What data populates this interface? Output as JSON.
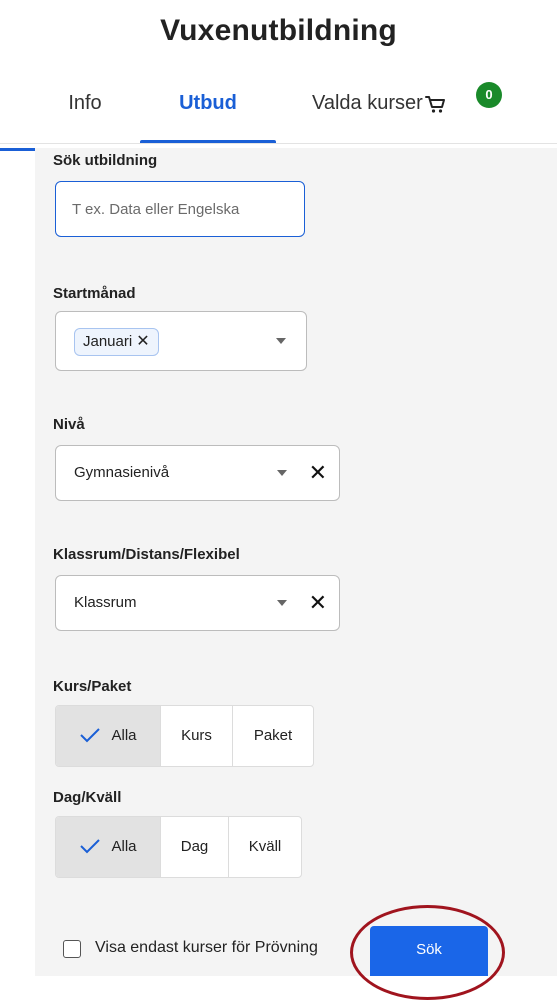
{
  "app": {
    "title": "Vuxenutbildning"
  },
  "tabs": [
    {
      "label": "Info"
    },
    {
      "label": "Utbud"
    },
    {
      "label": "Valda kurser"
    }
  ],
  "cart": {
    "count": "0"
  },
  "search": {
    "label": "Sök utbildning",
    "placeholder": "T ex. Data eller Engelska",
    "value": ""
  },
  "filters": {
    "startmanad": {
      "label": "Startmånad",
      "selected_chip": "Januari",
      "chip_remove": "✕"
    },
    "niva": {
      "label": "Nivå",
      "value": "Gymnasienivå",
      "clear": "✕"
    },
    "klassrum": {
      "label": "Klassrum/Distans/Flexibel",
      "value": "Klassrum",
      "clear": "✕"
    }
  },
  "kurs_paket": {
    "label": "Kurs/Paket",
    "options": [
      "Alla",
      "Kurs",
      "Paket"
    ],
    "selected": "Alla"
  },
  "dag_kvall": {
    "label": "Dag/Kväll",
    "options": [
      "Alla",
      "Dag",
      "Kväll"
    ],
    "selected": "Alla"
  },
  "provning": {
    "label": "Visa endast kurser för Prövning",
    "checked": false
  },
  "submit": {
    "label": "Sök"
  },
  "colors": {
    "accent": "#1a5fd6",
    "badge": "#1a8a2a",
    "highlight": "#a0141e",
    "panel": "#f4f4f4"
  },
  "icons": [
    "cart-icon",
    "check-icon",
    "caret-down-icon",
    "close-icon"
  ]
}
